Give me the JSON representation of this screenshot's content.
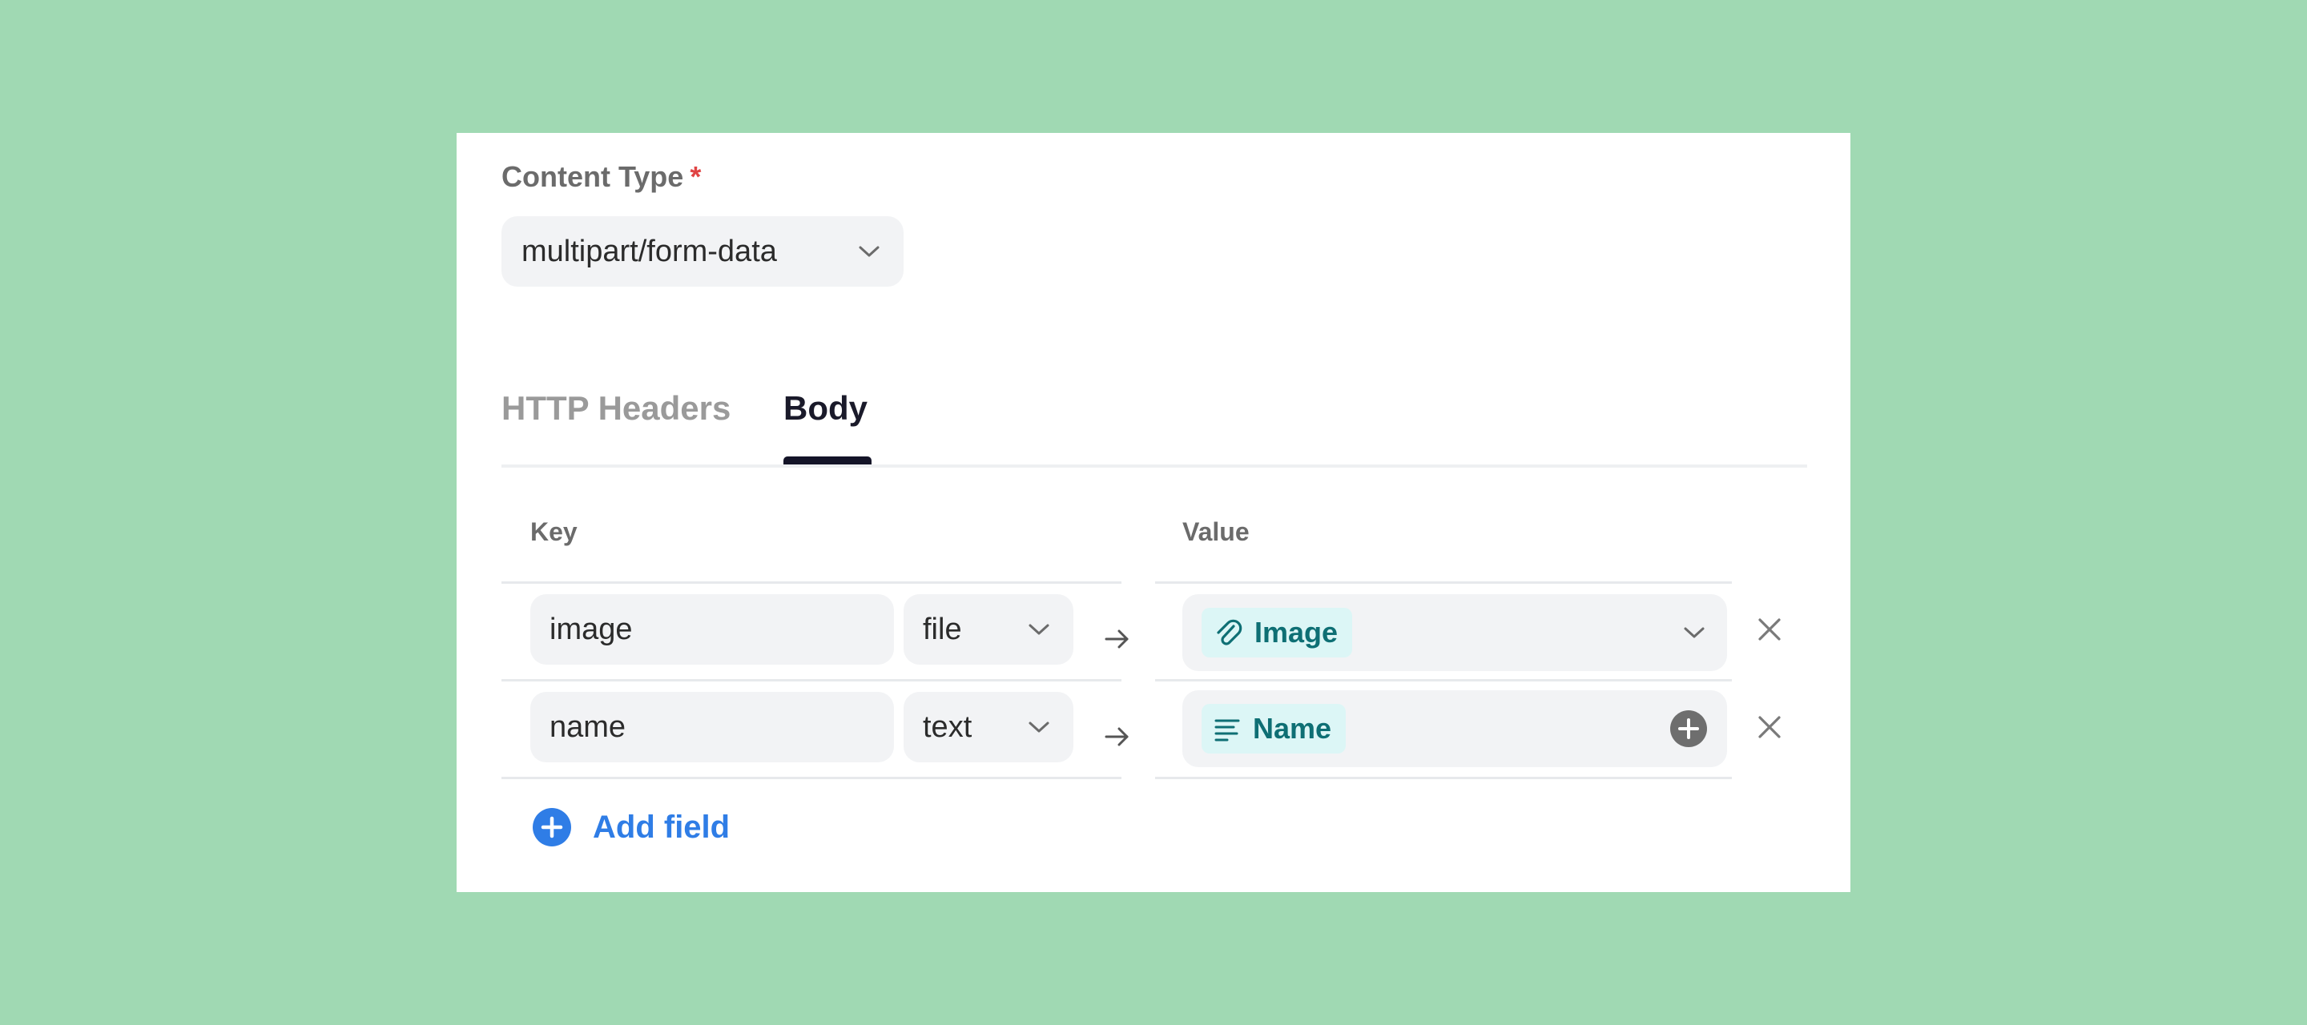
{
  "content_type": {
    "label": "Content Type",
    "required_mark": "*",
    "value": "multipart/form-data"
  },
  "tabs": [
    {
      "label": "HTTP Headers",
      "active": false
    },
    {
      "label": "Body",
      "active": true
    }
  ],
  "table": {
    "key_header": "Key",
    "value_header": "Value",
    "rows": [
      {
        "key": "image",
        "type": "file",
        "value_chip": "Image",
        "value_icon": "paperclip-icon",
        "value_control": "chevron-down-icon"
      },
      {
        "key": "name",
        "type": "text",
        "value_chip": "Name",
        "value_icon": "text-lines-icon",
        "value_control": "plus-circle-icon"
      }
    ]
  },
  "add_field_label": "Add field",
  "colors": {
    "background": "#a0d9b3",
    "accent_blue": "#2f7de6",
    "chip_bg": "#dcf6f6",
    "chip_text": "#0e6f74",
    "active_tab": "#141428",
    "required": "#e04444"
  }
}
